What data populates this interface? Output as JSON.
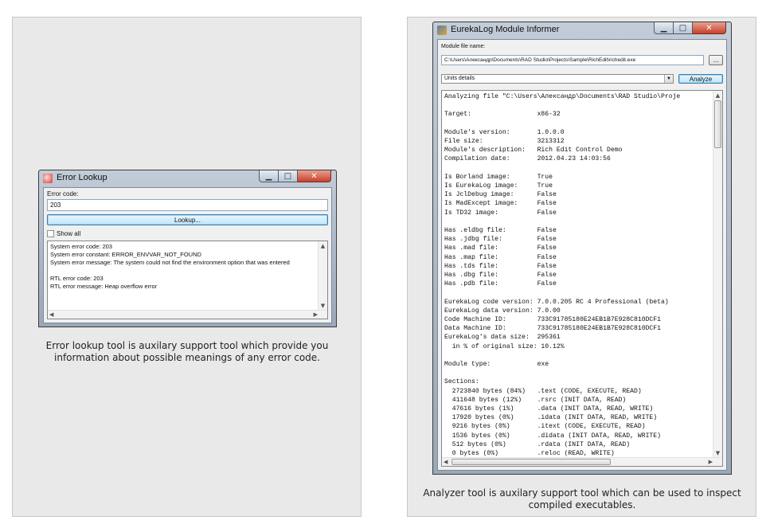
{
  "left": {
    "caption": "Error lookup tool is auxilary support tool which provide you information about possible meanings of any error code.",
    "window": {
      "title": "Error Lookup",
      "minimize_glyph": "▁",
      "maximize_glyph": "□",
      "close_glyph": "✕",
      "error_code_label": "Error code:",
      "error_code_value": "203",
      "lookup_button": "Lookup...",
      "show_all_label": "Show all",
      "result_lines": [
        "System error code: 203",
        "System error constant: ERROR_ENVVAR_NOT_FOUND",
        "System error message: The system could not find the environment option that was entered",
        "",
        "RTL error code: 203",
        "RTL error message: Heap overflow error"
      ]
    }
  },
  "right": {
    "caption": "Analyzer tool is auxilary support tool which can be used to inspect compiled executables.",
    "window": {
      "title": "EurekaLog Module Informer",
      "minimize_glyph": "▁",
      "maximize_glyph": "□",
      "close_glyph": "✕",
      "module_label": "Module file name:",
      "module_path": "C:\\Users\\Александр\\Documents\\RAD Studio\\Projects\\Sample\\RichEdit\\richedit.exe",
      "browse_button": "...",
      "mode_select": "Units details",
      "analyze_button": "Analyze",
      "output_lines": [
        "Analyzing file \"C:\\Users\\Александр\\Documents\\RAD Studio\\Proje",
        "",
        "Target:                 x86-32",
        "",
        "Module's version:       1.0.0.0",
        "File size:              3213312",
        "Module's description:   Rich Edit Control Demo",
        "Compilation date:       2012.04.23 14:03:56",
        "",
        "Is Borland image:       True",
        "Is EurekaLog image:     True",
        "Is JclDebug image:      False",
        "Is MadExcept image:     False",
        "Is TD32 image:          False",
        "",
        "Has .eldbg file:        False",
        "Has .jdbg file:         False",
        "Has .mad file:          False",
        "Has .map file:          False",
        "Has .tds file:          False",
        "Has .dbg file:          False",
        "Has .pdb file:          False",
        "",
        "EurekaLog code version: 7.0.0.205 RC 4 Professional (beta)",
        "EurekaLog data version: 7.0.00",
        "Code Machine ID:        733C91785180E24EB1B7E928C810DCF1",
        "Data Machine ID:        733C91785180E24EB1B7E928C810DCF1",
        "EurekaLog's data size:  295361",
        "  in % of original size: 10.12%",
        "",
        "Module type:            exe",
        "",
        "Sections:",
        "  2723840 bytes (84%)   .text (CODE, EXECUTE, READ)",
        "  411648 bytes (12%)    .rsrc (INIT DATA, READ)",
        "  47616 bytes (1%)      .data (INIT DATA, READ, WRITE)",
        "  17920 bytes (0%)      .idata (INIT DATA, READ, WRITE)",
        "  9216 bytes (0%)       .itext (CODE, EXECUTE, READ)",
        "  1536 bytes (0%)       .didata (INIT DATA, READ, WRITE)",
        "  512 bytes (0%)        .rdata (INIT DATA, READ)",
        "  0 bytes (0%)          .reloc (READ, WRITE)"
      ]
    }
  },
  "colors": {
    "panel_bg": "#e9e9e9",
    "panel_border": "#c8c8c8",
    "close_button": "#c8402b",
    "focus_border": "#3c7fb1"
  }
}
